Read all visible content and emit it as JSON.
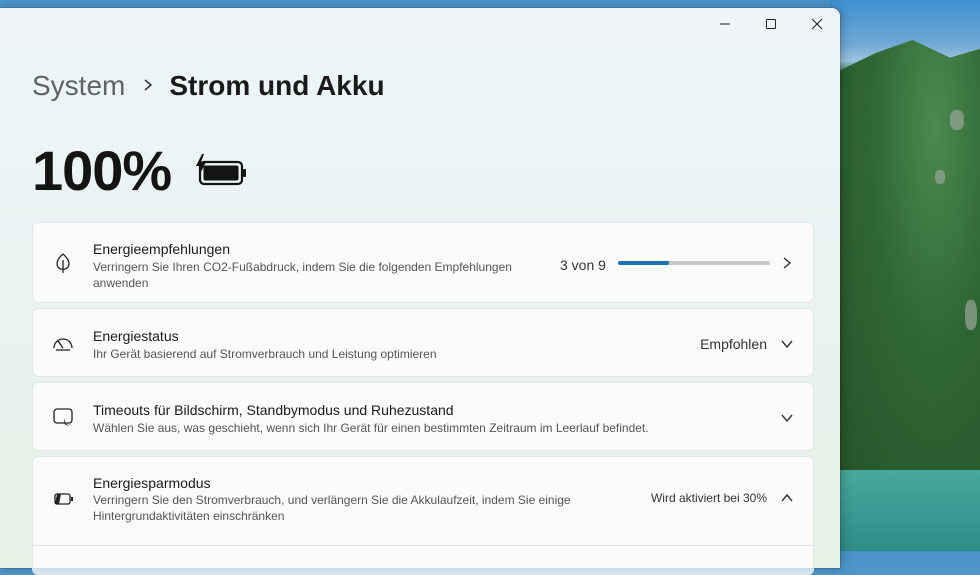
{
  "window": {
    "controls": {
      "minimize": "—",
      "maximize": "☐",
      "close": "✕"
    }
  },
  "breadcrumb": {
    "parent": "System",
    "separator": "›",
    "current": "Strom und Akku"
  },
  "battery": {
    "percent": "100%",
    "charging": true
  },
  "cards": {
    "recommendations": {
      "title": "Energieempfehlungen",
      "description": "Verringern Sie Ihren CO2-Fußabdruck, indem Sie die folgenden Empfehlungen anwenden",
      "count_text": "3 von 9",
      "progress_fraction": 0.333
    },
    "power_mode": {
      "title": "Energiestatus",
      "description": "Ihr Gerät basierend auf Stromverbrauch und Leistung optimieren",
      "value": "Empfohlen"
    },
    "timeouts": {
      "title": "Timeouts für Bildschirm, Standbymodus und Ruhezustand",
      "description": "Wählen Sie aus, was geschieht, wenn sich Ihr Gerät für einen bestimmten Zeitraum im Leerlauf befindet."
    },
    "energy_saver": {
      "title": "Energiesparmodus",
      "description": "Verringern Sie den Stromverbrauch, und verlängern Sie die Akkulaufzeit, indem Sie einige Hintergrundaktivitäten einschränken",
      "value": "Wird aktiviert bei 30%"
    }
  },
  "colors": {
    "accent": "#1f6fb8",
    "progress_track": "#c7c7c7"
  }
}
